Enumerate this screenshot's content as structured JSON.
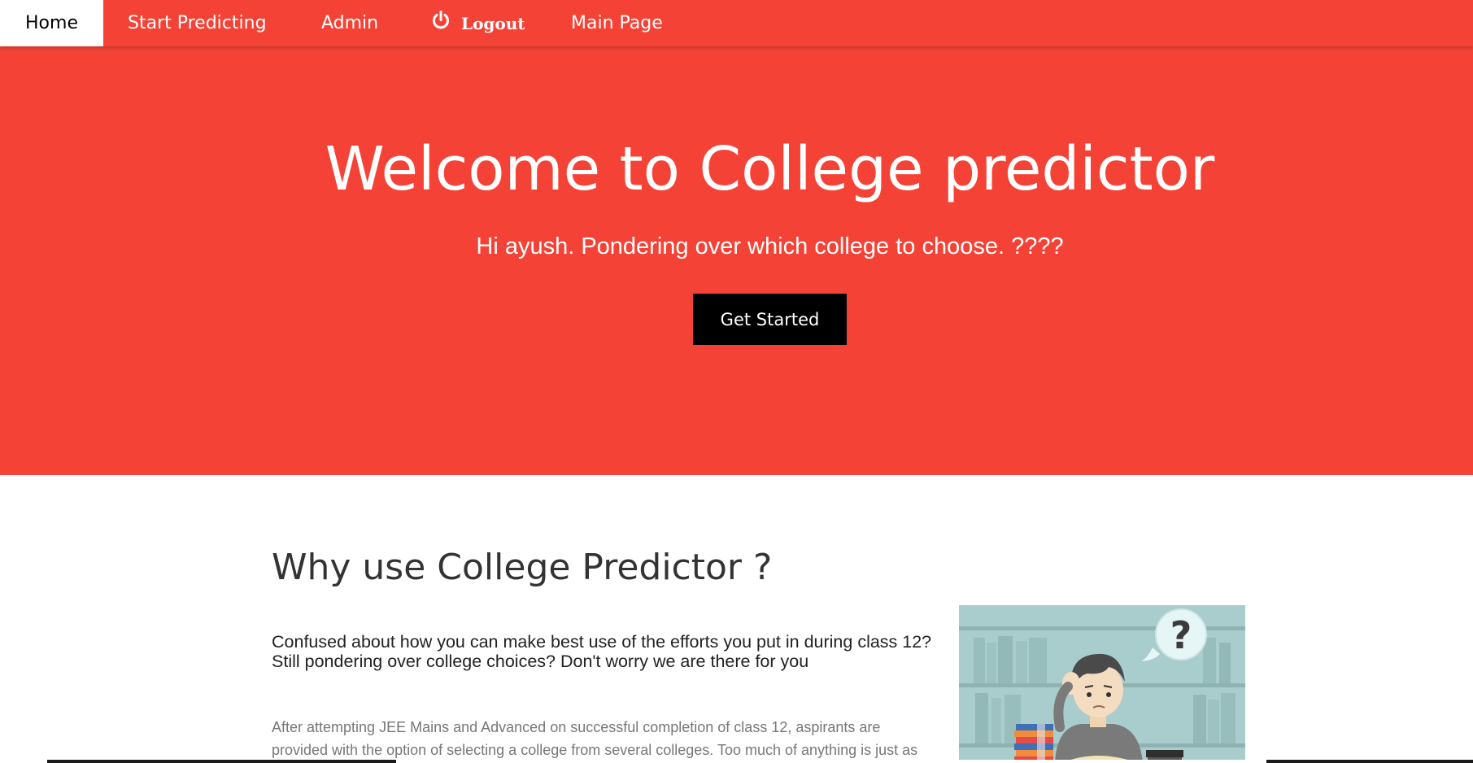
{
  "nav": {
    "home": "Home",
    "start_predicting": "Start Predicting",
    "admin": "Admin",
    "logout": "Logout",
    "main_page": "Main Page",
    "logout_icon": "power-icon"
  },
  "hero": {
    "title": "Welcome to College predictor",
    "subtitle": "Hi ayush. Pondering over which college to choose. ????",
    "cta_label": "Get Started"
  },
  "about": {
    "title": "Why use College Predictor ?",
    "lead": "Confused about how you can make best use of the efforts you put in during class 12? Still pondering over college choices? Don't worry we are there for you",
    "body": "After attempting JEE Mains and Advanced on successful completion of class 12, aspirants are provided with the option of selecting a college from several colleges. Too much of anything is just as",
    "illustration_icon": "confused-student-illustration",
    "illustration_text": "?"
  },
  "colors": {
    "primary": "#f44336",
    "cta_background": "#000000",
    "text_dark": "#333333",
    "text_muted": "#777777"
  }
}
